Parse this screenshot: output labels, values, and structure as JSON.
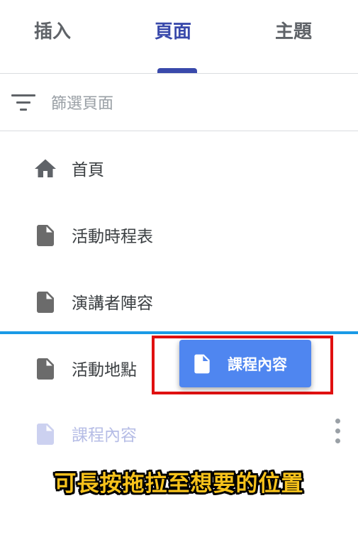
{
  "tabs": [
    {
      "label": "插入",
      "active": false
    },
    {
      "label": "頁面",
      "active": true
    },
    {
      "label": "主題",
      "active": false
    }
  ],
  "filter": {
    "placeholder": "篩選頁面",
    "value": "",
    "icon": "filter-list-icon"
  },
  "pages": [
    {
      "label": "首頁",
      "icon": "home-icon"
    },
    {
      "label": "活動時程表",
      "icon": "page-icon"
    },
    {
      "label": "演講者陣容",
      "icon": "page-icon"
    },
    {
      "label": "活動地點",
      "icon": "page-icon"
    },
    {
      "label": "課程內容",
      "icon": "page-icon",
      "state": "dragging-placeholder"
    }
  ],
  "drag_chip": {
    "label": "課程內容",
    "icon": "page-icon"
  },
  "annotation": {
    "caption": "可長按拖拉至想要的位置"
  },
  "colors": {
    "accent": "#3949ab",
    "drop_indicator": "#1a9ae6",
    "drag_chip": "#4f86f0",
    "highlight_border": "#e01010",
    "caption_text": "#f7c21b",
    "icon_gray": "#5f6368",
    "placeholder_item": "#b6bde6"
  }
}
